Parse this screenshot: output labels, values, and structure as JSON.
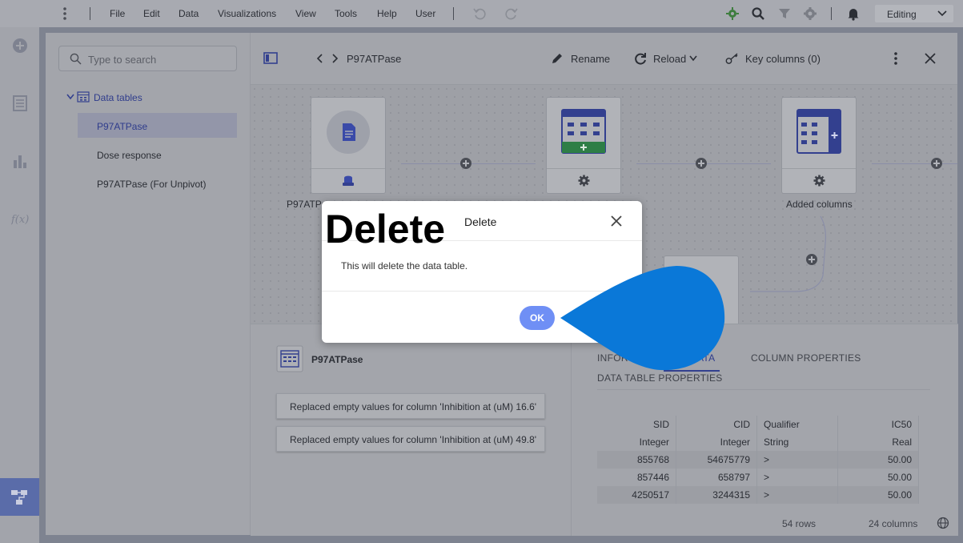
{
  "menubar": {
    "items": [
      "File",
      "Edit",
      "Data",
      "Visualizations",
      "View",
      "Tools",
      "Help",
      "User"
    ],
    "mode": "Editing"
  },
  "sidebar": {
    "search_placeholder": "Type to search",
    "tree_root": "Data tables",
    "tables": [
      "P97ATPase",
      "Dose response",
      "P97ATPase (For Unpivot)"
    ],
    "selected_index": 0
  },
  "toolbar": {
    "breadcrumb": "P97ATPase",
    "rename": "Rename",
    "reload": "Reload",
    "key_columns": "Key columns (0)"
  },
  "canvas": {
    "node1_label": "P97ATPa",
    "node3_label": "Added columns"
  },
  "details": {
    "table_name": "P97ATPase",
    "transforms": [
      "Replaced empty values for column 'Inhibition at (uM) 16.6'",
      "Replaced empty values for column 'Inhibition at (uM) 49.8'"
    ],
    "tabs": {
      "info_partial": "INFOR",
      "data_partial": "ATA",
      "column_properties": "COLUMN PROPERTIES",
      "data_table_properties": "DATA TABLE PROPERTIES"
    },
    "grid": {
      "headers": [
        "SID",
        "CID",
        "Qualifier",
        "IC50"
      ],
      "types": [
        "Integer",
        "Integer",
        "String",
        "Real"
      ],
      "rows": [
        [
          "855768",
          "54675779",
          ">",
          "50.00"
        ],
        [
          "857446",
          "658797",
          ">",
          "50.00"
        ],
        [
          "4250517",
          "3244315",
          ">",
          "50.00"
        ]
      ]
    },
    "rows_count": "54 rows",
    "columns_count": "24 columns"
  },
  "dialog": {
    "overlay_heading": "Delete",
    "title": "Delete",
    "message": "This will delete the data table.",
    "ok_label": "OK"
  },
  "colors": {
    "accent": "#6f8ff5",
    "pointer": "#0a78d8",
    "data_table_green": "#2e9e4f",
    "data_table_blue": "#3344b0"
  }
}
